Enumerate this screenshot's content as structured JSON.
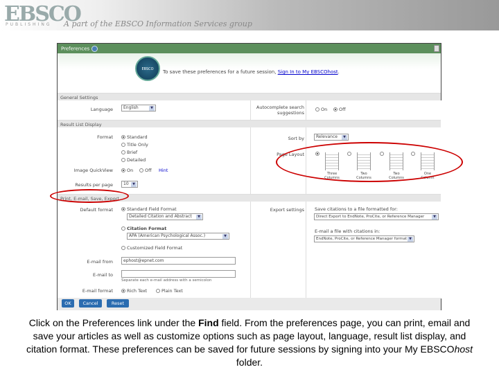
{
  "banner": {
    "logo": "EBSCO",
    "logo_sub": "PUBLISHING",
    "tagline": "A part of the EBSCO Information Services group"
  },
  "panel": {
    "title": "Preferences",
    "signin_text": "To save these preferences for a future session, ",
    "signin_link": "Sign In to My EBSCOhost",
    "signin_end": ".",
    "badge": "EBSCO"
  },
  "general": {
    "header": "General Settings",
    "language_label": "Language",
    "language_value": "English",
    "autocomplete_label": "Autocomplete search suggestions",
    "on": "On",
    "off": "Off"
  },
  "results": {
    "header": "Result List Display",
    "format_label": "Format",
    "formats": [
      "Standard",
      "Title Only",
      "Brief",
      "Detailed"
    ],
    "quickview_label": "Image QuickView",
    "on": "On",
    "off": "Off",
    "hint": "Hint",
    "per_page_label": "Results per page",
    "per_page_value": "10",
    "sort_label": "Sort by",
    "sort_value": "Relevance",
    "layout_label": "Page Layout",
    "layouts": [
      "Three Columns",
      "Two Columns",
      "Two Columns",
      "One Column"
    ]
  },
  "print": {
    "header": "Print, E-mail, Save, Export",
    "default_label": "Default format",
    "standard_field": "Standard Field Format",
    "standard_value": "Detailed Citation and Abstract",
    "citation_format": "Citation Format",
    "citation_value": "APA (American Psychological Assoc.)",
    "custom_field": "Customized Field Format",
    "email_from_label": "E-mail from",
    "email_from_value": "ephost@epnet.com",
    "email_to_label": "E-mail to",
    "email_to_hint": "Separate each e-mail address with a semicolon",
    "email_format_label": "E-mail format",
    "rich": "Rich Text",
    "plain": "Plain Text",
    "export_label": "Export settings",
    "save_label": "Save citations to a file formatted for:",
    "save_value": "Direct Export to EndNote, ProCite, or Reference Manager",
    "email_cit_label": "E-mail a file with citations in:",
    "email_cit_value": "EndNote, ProCite, or Reference Manager format"
  },
  "buttons": {
    "ok": "OK",
    "cancel": "Cancel",
    "reset": "Reset"
  },
  "caption": {
    "p1": "Click on the Preferences link under the ",
    "find": "Find",
    "p2": " field. From the preferences page, you can print, email and save your articles as well as customize options such as page layout, language, result list display, and citation format. These preferences can be saved for future sessions by signing into your My EBSCO",
    "host": "host",
    "p3": " folder."
  }
}
